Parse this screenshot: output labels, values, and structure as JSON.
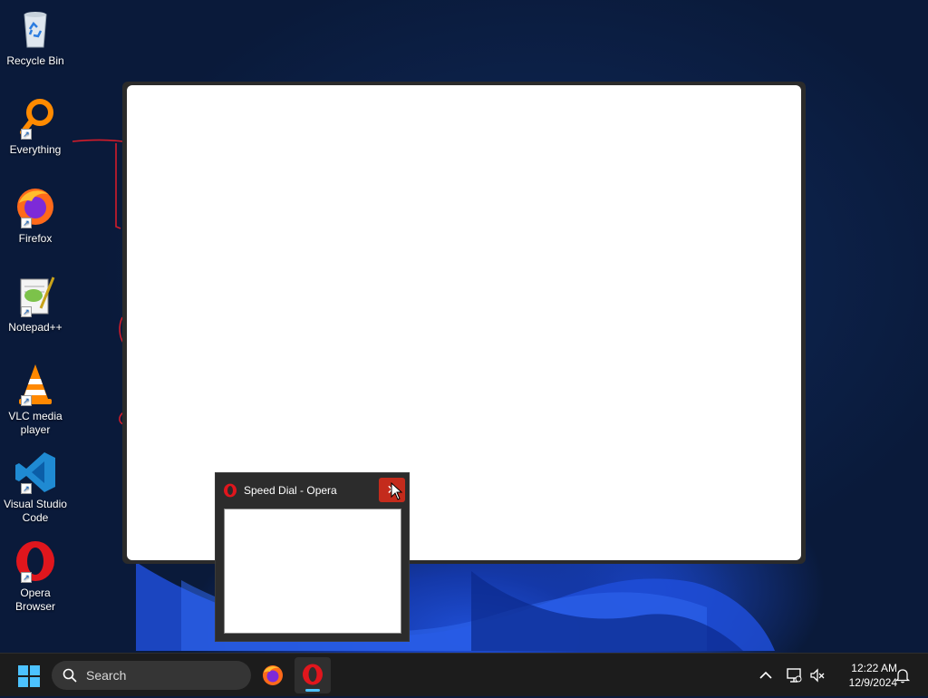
{
  "desktop": {
    "icons": [
      {
        "label": "Recycle Bin"
      },
      {
        "label": "Everything"
      },
      {
        "label": "Firefox"
      },
      {
        "label": "Notepad++"
      },
      {
        "label": "VLC media player"
      },
      {
        "label": "Visual Studio Code"
      },
      {
        "label": "Opera Browser"
      }
    ]
  },
  "thumbnail": {
    "title": "Speed Dial - Opera",
    "close_label": "✕"
  },
  "taskbar": {
    "search_placeholder": "Search",
    "clock": {
      "time": "12:22 AM",
      "date": "12/9/2024"
    }
  },
  "colors": {
    "taskbar_bg": "#1c1c1c",
    "close_hover": "#c42b1c",
    "opera_red": "#e0161d",
    "accent": "#4cc2ff"
  }
}
